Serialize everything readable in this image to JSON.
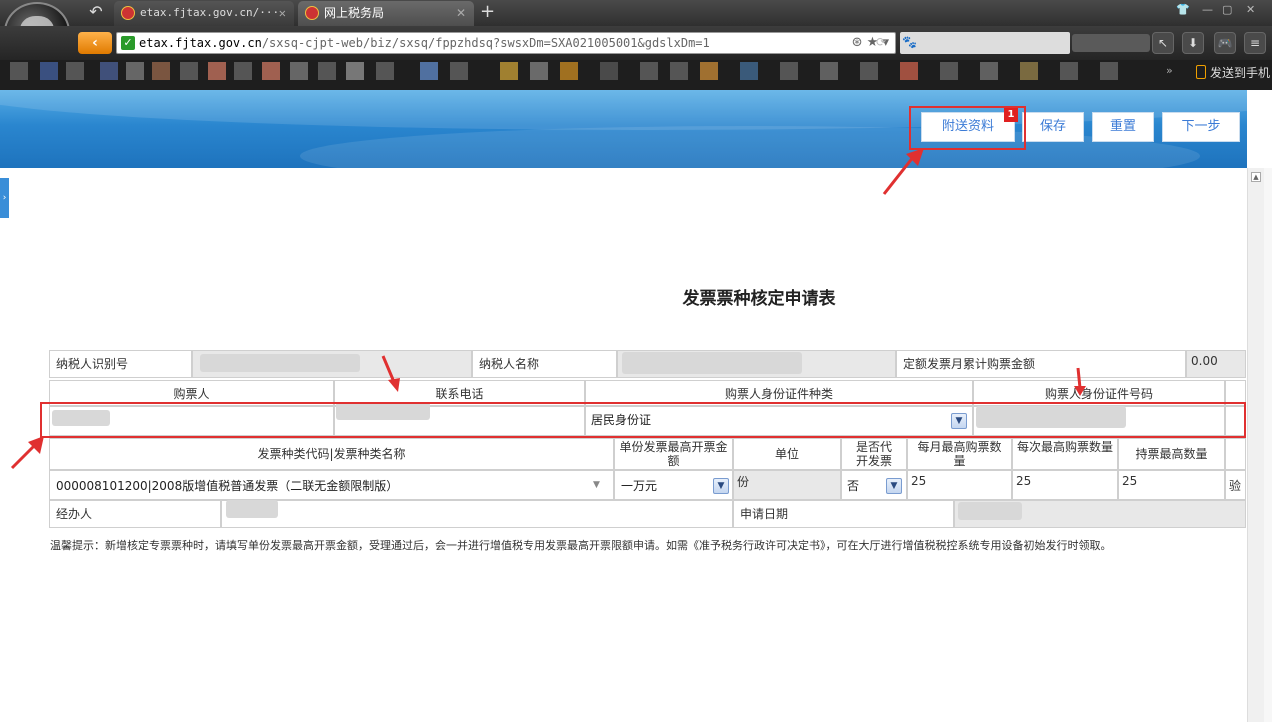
{
  "browser": {
    "tabs": [
      {
        "label": "etax.fjtax.gov.cn/···",
        "close": "✕"
      },
      {
        "label": "网上税务局",
        "close": "✕"
      }
    ],
    "new_tab": "+",
    "url_host": "etax.fjtax.gov.cn",
    "url_path": "/sxsq-cjpt-web/biz/sxsq/fppzhdsq?swsxDm=SXA021005001&gdslxDm=1",
    "send_to_phone": "发送到手机",
    "more": "»"
  },
  "header": {
    "buttons": [
      "附送资料",
      "保存",
      "重置",
      "下一步"
    ],
    "attach_badge": "1"
  },
  "form": {
    "title": "发票票种核定申请表",
    "taxpayer_id_label": "纳税人识别号",
    "taxpayer_name_label": "纳税人名称",
    "quota_label": "定额发票月累计购票金额",
    "quota_value": "0.00",
    "buyer_header": "购票人",
    "phone_header": "联系电话",
    "id_type_header": "购票人身份证件种类",
    "id_number_header": "购票人身份证件号码",
    "id_type_value": "居民身份证",
    "invoice_code_header": "发票种类代码|发票种类名称",
    "max_amount_header": "单份发票最高开票金额",
    "unit_header": "单位",
    "proxy_header": "是否代开发票",
    "monthly_header": "每月最高购票数量",
    "each_header": "每次最高购票数量",
    "hold_header": "持票最高数量",
    "invoice_code_value": "000008101200|2008版增值税普通发票（二联无金额限制版）",
    "max_amount_value": "一万元",
    "unit_value": "份",
    "proxy_value": "否",
    "monthly_value": "25",
    "each_value": "25",
    "hold_value": "25",
    "extra_col": "验",
    "handler_label": "经办人",
    "apply_date_label": "申请日期"
  },
  "tip": "温馨提示：新增核定专票票种时，请填写单份发票最高开票金额，受理通过后，会一并进行增值税专用发票最高开票限额申请。如需《准予税务行政许可决定书》，可在大厅进行增值税税控系统专用设备初始发行时领取。"
}
